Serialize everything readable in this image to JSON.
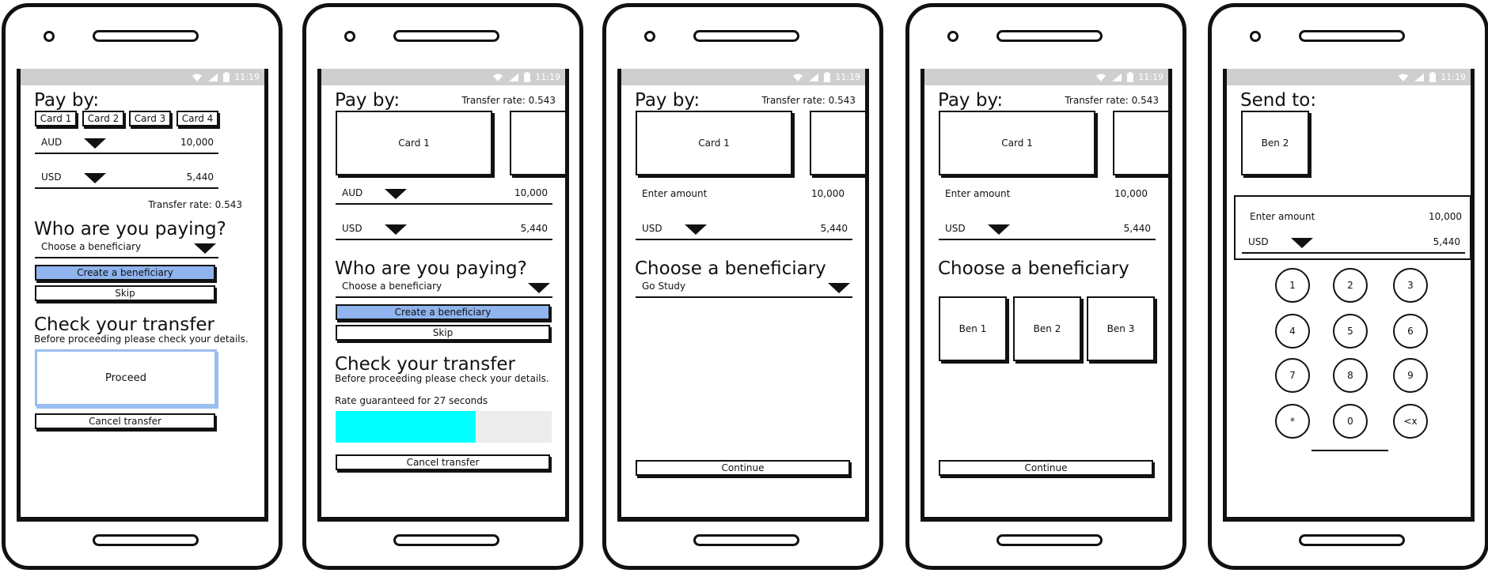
{
  "status": {
    "time": "11:19"
  },
  "screen1": {
    "title": "Pay by:",
    "cards": [
      "Card 1",
      "Card 2",
      "Card 3",
      "Card 4"
    ],
    "from_currency": "AUD",
    "from_amount": "10,000",
    "to_currency": "USD",
    "to_amount": "5,440",
    "rate": "Transfer rate: 0.543",
    "heading_paying": "Who are you paying?",
    "beneficiary_placeholder": "Choose a beneficiary",
    "create_label": "Create a beneficiary",
    "skip_label": "Skip",
    "heading_check": "Check your transfer",
    "check_note": "Before proceeding please check your details.",
    "proceed_label": "Proceed",
    "cancel_label": "Cancel transfer"
  },
  "screen2": {
    "title": "Pay by:",
    "rate": "Transfer rate: 0.543",
    "card": "Card 1",
    "from_currency": "AUD",
    "from_amount": "10,000",
    "to_currency": "USD",
    "to_amount": "5,440",
    "heading_paying": "Who are you paying?",
    "beneficiary_placeholder": "Choose a beneficiary",
    "create_label": "Create a beneficiary",
    "skip_label": "Skip",
    "heading_check": "Check your transfer",
    "check_note": "Before proceeding please check your details.",
    "guarantee": "Rate guaranteed for 27 seconds",
    "guarantee_progress": 0.65,
    "cancel_label": "Cancel transfer"
  },
  "screen3": {
    "title": "Pay by:",
    "rate": "Transfer rate: 0.543",
    "card": "Card 1",
    "enter_label": "Enter amount",
    "enter_amount": "10,000",
    "to_currency": "USD",
    "to_amount": "5,440",
    "heading_beneficiary": "Choose a beneficiary",
    "beneficiary_value": "Go Study",
    "continue_label": "Continue"
  },
  "screen4": {
    "title": "Pay by:",
    "rate": "Transfer rate: 0.543",
    "card": "Card 1",
    "enter_label": "Enter amount",
    "enter_amount": "10,000",
    "to_currency": "USD",
    "to_amount": "5,440",
    "heading_beneficiary": "Choose a beneficiary",
    "beneficiaries": [
      "Ben 1",
      "Ben 2",
      "Ben 3"
    ],
    "continue_label": "Continue"
  },
  "screen5": {
    "title": "Send to:",
    "beneficiary": "Ben 2",
    "enter_label": "Enter amount",
    "enter_amount": "10,000",
    "to_currency": "USD",
    "to_amount": "5,440",
    "keys": [
      "1",
      "2",
      "3",
      "4",
      "5",
      "6",
      "7",
      "8",
      "9",
      "*",
      "0",
      "<x"
    ]
  }
}
